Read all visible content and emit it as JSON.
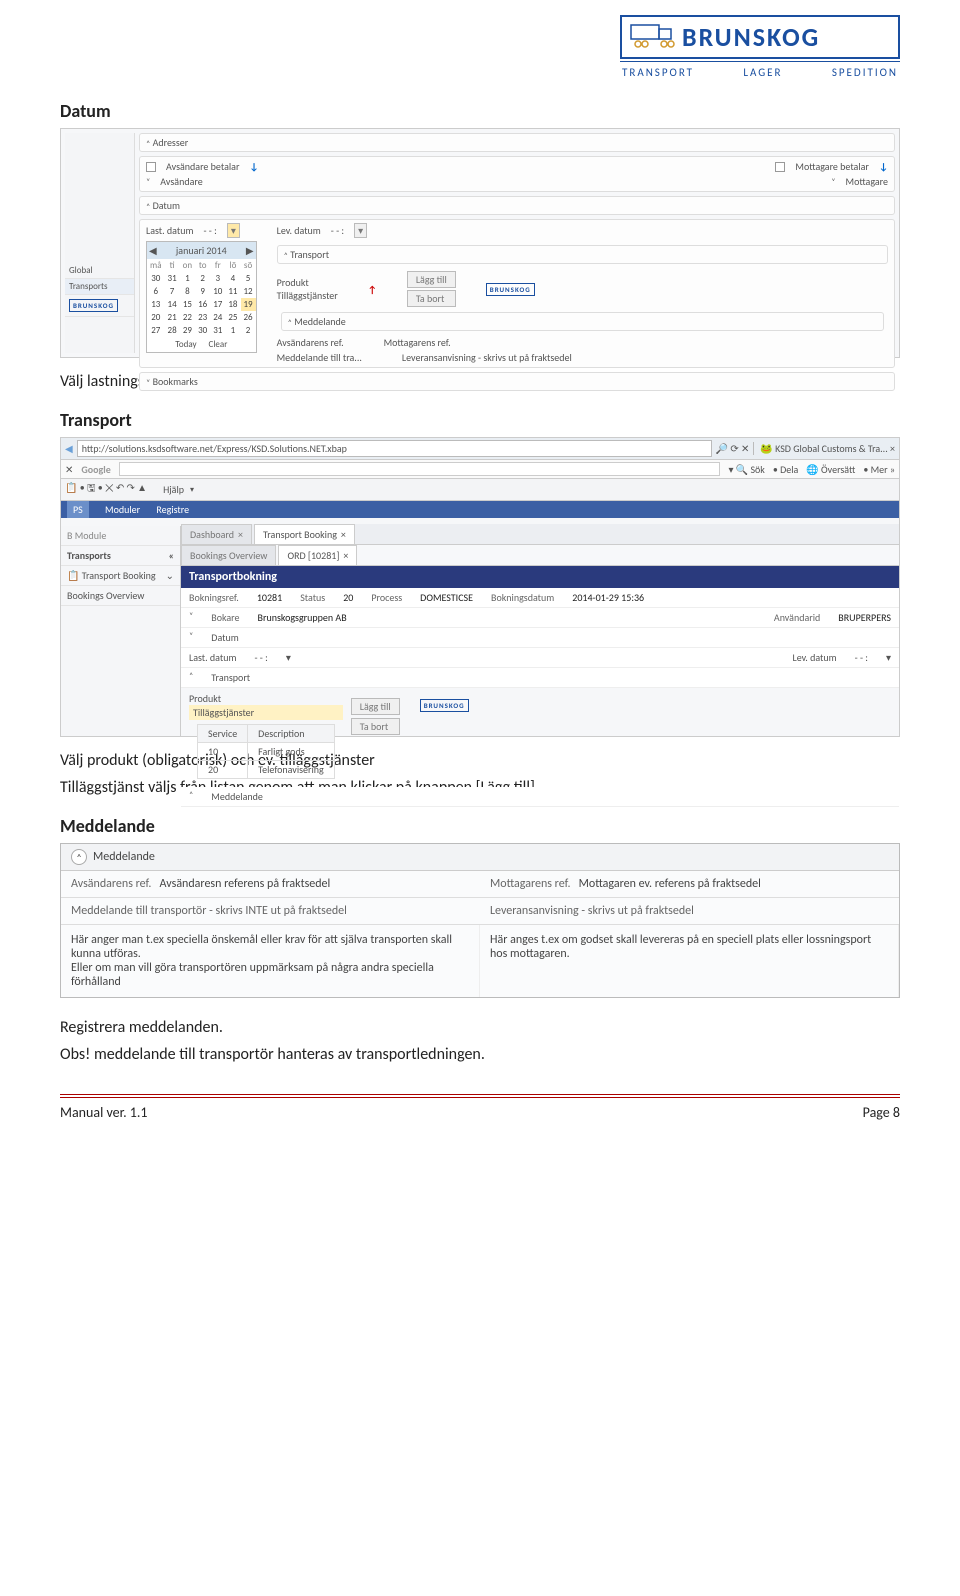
{
  "logo": {
    "name": "BRUNSKOG",
    "sub1": "TRANSPORT",
    "sub2": "LAGER",
    "sub3": "SPEDITION"
  },
  "h_datum": "Datum",
  "p_datum": "Välj lastningsdatum och leveransdatum i kalendern.",
  "h_transport": "Transport",
  "p_transport1": "Välj produkt (obligatorisk) och ev. tilläggstjänster",
  "p_transport2": "Tilläggstjänst väljs från listan genom att man klickar på knappen [Lägg till].",
  "h_meddelande": "Meddelande",
  "p_reg": "Registrera meddelanden.",
  "p_obs": "Obs! meddelande till transportör hanteras av transportledningen.",
  "footer": {
    "left": "Manual ver. 1.1",
    "right": "Page 8"
  },
  "shot1": {
    "side": {
      "global": "Global",
      "transports": "Transports",
      "mini": "BRUNSKOG"
    },
    "adresser": "Adresser",
    "avs_bet": "Avsändare betalar",
    "mot_bet": "Mottagare betalar",
    "avsandare": "Avsändare",
    "mottagare": "Mottagare",
    "datum": "Datum",
    "last_datum": "Last. datum",
    "lev_datum": "Lev. datum",
    "cal_month": "januari 2014",
    "cal_days": [
      "må",
      "ti",
      "on",
      "to",
      "fr",
      "lö",
      "sö"
    ],
    "cal_rows": [
      [
        "30",
        "31",
        "1",
        "2",
        "3",
        "4",
        "5"
      ],
      [
        "6",
        "7",
        "8",
        "9",
        "10",
        "11",
        "12"
      ],
      [
        "13",
        "14",
        "15",
        "16",
        "17",
        "18",
        "19"
      ],
      [
        "20",
        "21",
        "22",
        "23",
        "24",
        "25",
        "26"
      ],
      [
        "27",
        "28",
        "29",
        "30",
        "31",
        "1",
        "2"
      ]
    ],
    "today": "Today",
    "clear": "Clear",
    "transport": "Transport",
    "produkt": "Produkt",
    "tillagg": "Tilläggstjänster",
    "lagg_till": "Lägg till",
    "ta_bort": "Ta bort",
    "meddelande": "Meddelande",
    "avs_ref": "Avsändarens ref.",
    "mot_ref": "Mottagarens ref.",
    "medd_till": "Meddelande till tra...",
    "lev_anv": "Leveransanvisning - skrivs ut på fraktsedel",
    "bookmarks": "Bookmarks"
  },
  "shot2": {
    "url": "http://solutions.ksdsoftware.net/Express/KSD.Solutions.NET.xbap",
    "tab_title": "KSD Global Customs & Tra...",
    "google": "Google",
    "sok": "Sök",
    "dela": "Dela",
    "oversatt": "Översätt",
    "mer": "Mer »",
    "hjalp": "Hjälp",
    "ps": "PS",
    "moduler": "Moduler",
    "registre": "Registre",
    "bmodule": "B Module",
    "side_transports": "Transports",
    "side_tb": "Transport Booking",
    "side_bo": "Bookings Overview",
    "tab_dash": "Dashboard",
    "tab_tb": "Transport Booking",
    "sub_bo": "Bookings Overview",
    "sub_ord": "ORD [10281]",
    "blue": "Transportbokning",
    "bokningsref_l": "Bokningsref.",
    "bokningsref_v": "10281",
    "status_l": "Status",
    "status_v": "20",
    "process_l": "Process",
    "process_v": "DOMESTICSE",
    "bokdate_l": "Bokningsdatum",
    "bokdate_v": "2014-01-29 15:36",
    "bokare_l": "Bokare",
    "bokare_v": "Brunskogsgruppen AB",
    "anvid_l": "Användarid",
    "anvid_v": "BRUPERPERS",
    "datum": "Datum",
    "last_datum": "Last. datum",
    "lev_datum": "Lev. datum",
    "transport": "Transport",
    "produkt": "Produkt",
    "tillagg": "Tilläggstjänster",
    "lagg_till": "Lägg till",
    "ta_bort": "Ta bort",
    "th_service": "Service",
    "th_desc": "Description",
    "r1s": "10",
    "r1d": "Farligt gods",
    "r2s": "20",
    "r2d": "Telefonavisering",
    "meddelande": "Meddelande"
  },
  "shot3": {
    "header": "Meddelande",
    "avs_ref_l": "Avsändarens ref.",
    "avs_ref_v": "Avsändaresn referens på fraktsedel",
    "mot_ref_l": "Mottagarens ref.",
    "mot_ref_v": "Mottagaren ev. referens på fraktsedel",
    "left_h": "Meddelande till transportör - skrivs INTE ut på fraktsedel",
    "left_b": "Här anger man t.ex speciella önskemål eller krav för att själva transporten skall kunna utföras.\nEller om man vill göra transportören uppmärksam på några andra speciella förhålland",
    "right_h": "Leveransanvisning - skrivs ut på fraktsedel",
    "right_b": "Här anges t.ex om godset skall levereras på en speciell plats eller lossningsport hos mottagaren."
  }
}
